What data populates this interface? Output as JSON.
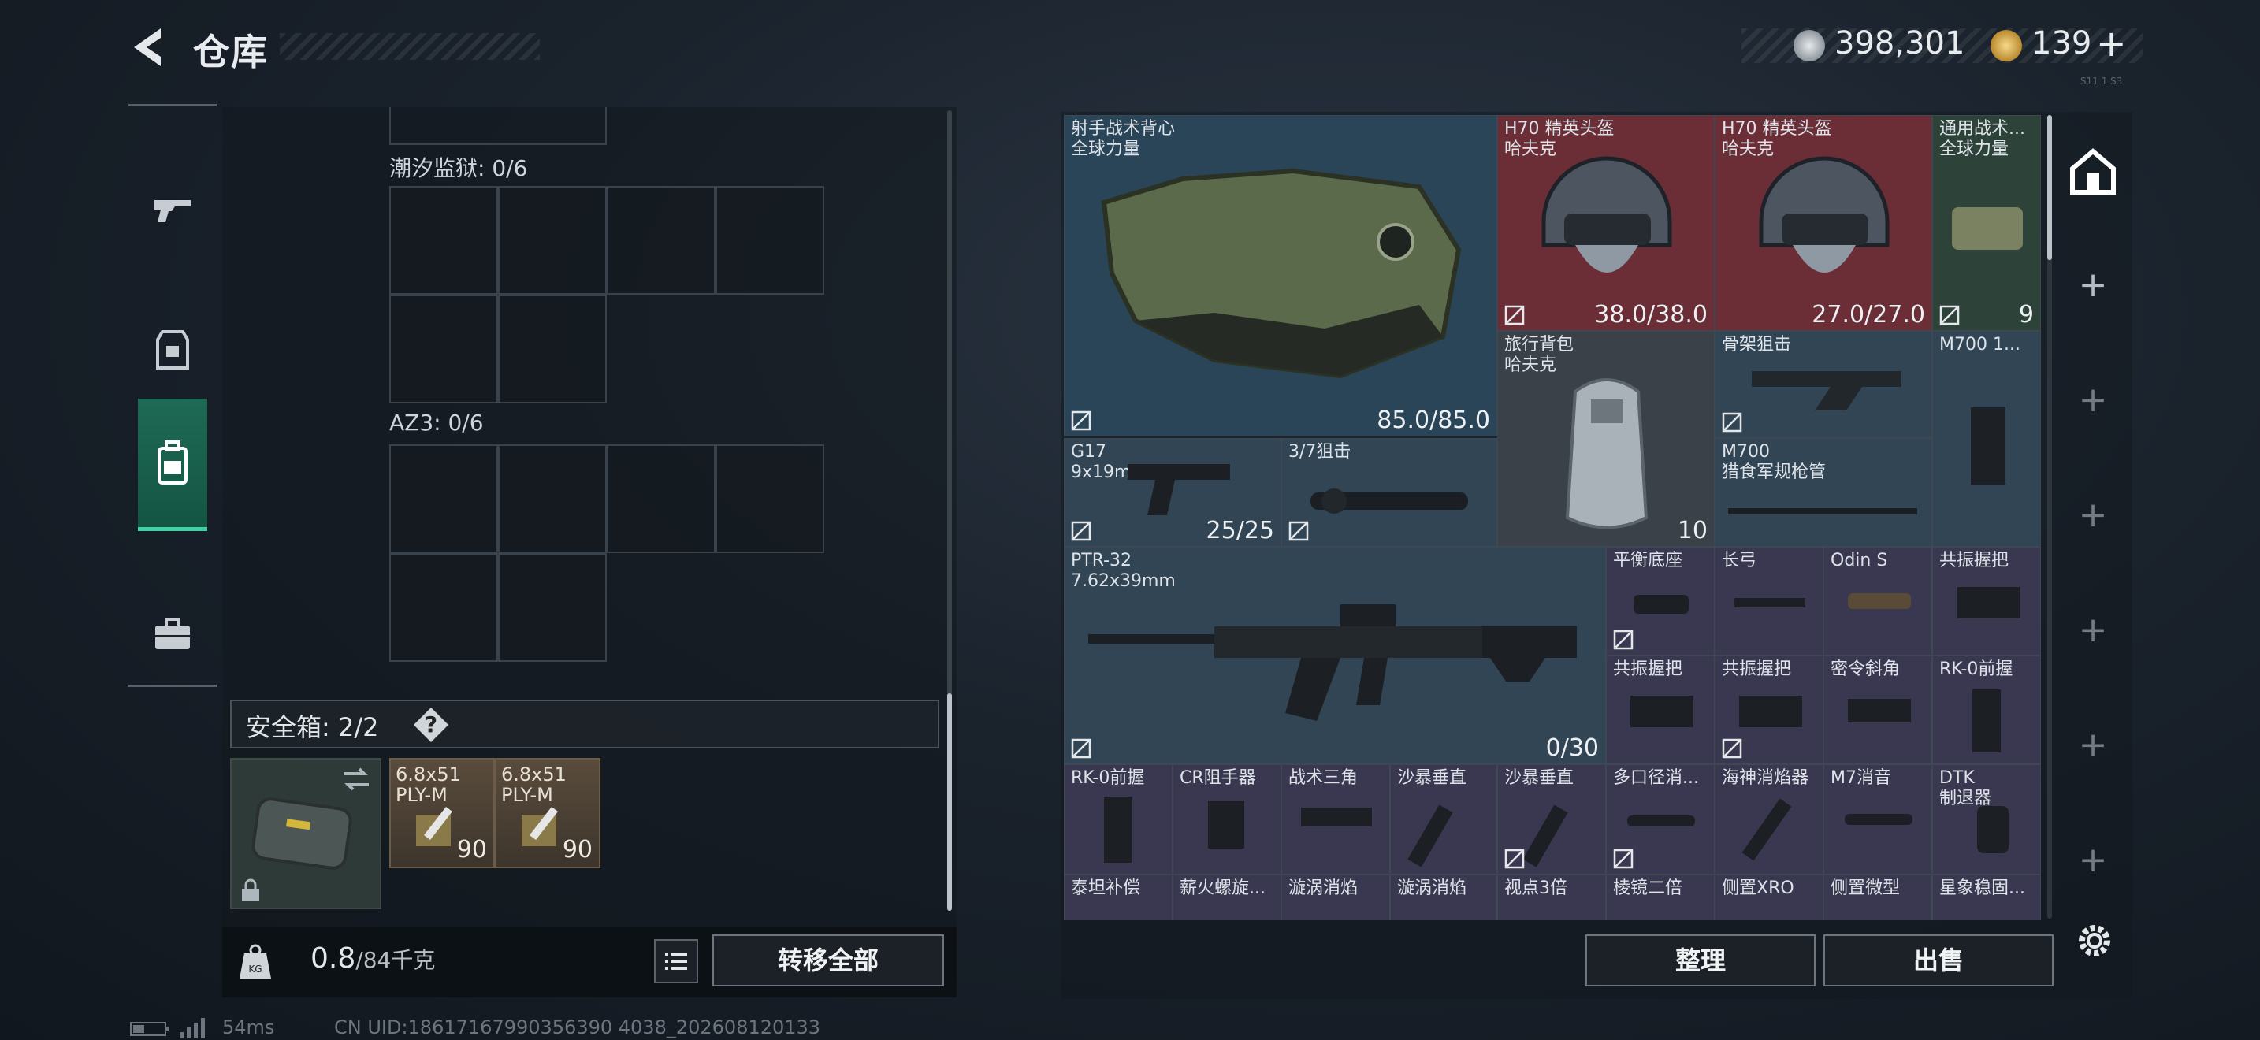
{
  "header": {
    "title": "仓库",
    "currency_silver": "398,301",
    "currency_gold": "139",
    "add_label": "+",
    "tiny_badge": "S11 1 S3"
  },
  "left_tabs": [
    "pistol-icon",
    "armor-icon",
    "backpack-icon",
    "briefcase-icon"
  ],
  "containers": [
    {
      "label": "潮汐监狱: 0/6"
    },
    {
      "label": "AZ3: 0/6"
    }
  ],
  "safe_box": {
    "label": "安全箱: 2/2",
    "help": "?",
    "ammo": [
      {
        "name": "6.8x51\nPLY-M",
        "count": "90"
      },
      {
        "name": "6.8x51\nPLY-M",
        "count": "90"
      }
    ]
  },
  "weight": {
    "value": "0.8",
    "capacity": "/84千克",
    "icon_label": "KG"
  },
  "left_buttons": {
    "transfer_all": "转移全部"
  },
  "items": [
    {
      "id": "vest",
      "name": "射手战术背心\n全球力量",
      "value": "85.0/85.0"
    },
    {
      "id": "h70a",
      "name": "H70 精英头盔\n哈夫克",
      "value": "38.0/38.0"
    },
    {
      "id": "h70b",
      "name": "H70 精英头盔\n哈夫克",
      "value": "27.0/27.0"
    },
    {
      "id": "pouch",
      "name": "通用战术...\n全球力量",
      "value": "9"
    },
    {
      "id": "bag",
      "name": "旅行背包\n哈夫克",
      "value": "10"
    },
    {
      "id": "stock",
      "name": "骨架狙击",
      "value": ""
    },
    {
      "id": "m700mag",
      "name": "M700 1...",
      "value": ""
    },
    {
      "id": "g17",
      "name": "G17\n9x19mm",
      "value": "25/25"
    },
    {
      "id": "scope37",
      "name": "3/7狙击",
      "value": ""
    },
    {
      "id": "m700barrel",
      "name": "M700\n猎食军规枪管",
      "value": ""
    },
    {
      "id": "ptr32",
      "name": "PTR-32\n7.62x39mm",
      "value": "0/30"
    },
    {
      "id": "a1",
      "name": "平衡底座",
      "value": ""
    },
    {
      "id": "a2",
      "name": "长弓",
      "value": ""
    },
    {
      "id": "a3",
      "name": "Odin S",
      "value": ""
    },
    {
      "id": "a4",
      "name": "共振握把",
      "value": ""
    },
    {
      "id": "b1",
      "name": "共振握把",
      "value": ""
    },
    {
      "id": "b2",
      "name": "共振握把",
      "value": ""
    },
    {
      "id": "b3",
      "name": "密令斜角",
      "value": ""
    },
    {
      "id": "b4",
      "name": "RK-0前握",
      "value": ""
    },
    {
      "id": "c1",
      "name": "RK-0前握",
      "value": ""
    },
    {
      "id": "c2",
      "name": "CR阻手器",
      "value": ""
    },
    {
      "id": "c3",
      "name": "战术三角",
      "value": ""
    },
    {
      "id": "c4",
      "name": "沙暴垂直",
      "value": ""
    },
    {
      "id": "c5",
      "name": "沙暴垂直",
      "value": ""
    },
    {
      "id": "c6",
      "name": "多口径消...",
      "value": ""
    },
    {
      "id": "c7",
      "name": "海神消焰器",
      "value": ""
    },
    {
      "id": "c8",
      "name": "M7消音",
      "value": ""
    },
    {
      "id": "c9",
      "name": "DTK\n制退器",
      "value": ""
    },
    {
      "id": "d1",
      "name": "泰坦补偿",
      "value": ""
    },
    {
      "id": "d2",
      "name": "薪火螺旋...",
      "value": ""
    },
    {
      "id": "d3",
      "name": "漩涡消焰",
      "value": ""
    },
    {
      "id": "d4",
      "name": "漩涡消焰",
      "value": ""
    },
    {
      "id": "d5",
      "name": "视点3倍",
      "value": ""
    },
    {
      "id": "d6",
      "name": "棱镜二倍",
      "value": ""
    },
    {
      "id": "d7",
      "name": "侧置XRO",
      "value": ""
    },
    {
      "id": "d8",
      "name": "侧置微型",
      "value": ""
    },
    {
      "id": "d9",
      "name": "星象稳固...",
      "value": ""
    }
  ],
  "right_buttons": {
    "sort": "整理",
    "sell": "出售"
  },
  "side_plus": [
    "+",
    "+",
    "+",
    "+",
    "+",
    "+"
  ],
  "footer": {
    "ping": "54ms",
    "uid": "CN UID:18617167990356390 4038_202608120133"
  },
  "colors": {
    "accent": "#3ed3a5",
    "red_item": "#6b2e36",
    "blue_item": "#2a4557"
  }
}
